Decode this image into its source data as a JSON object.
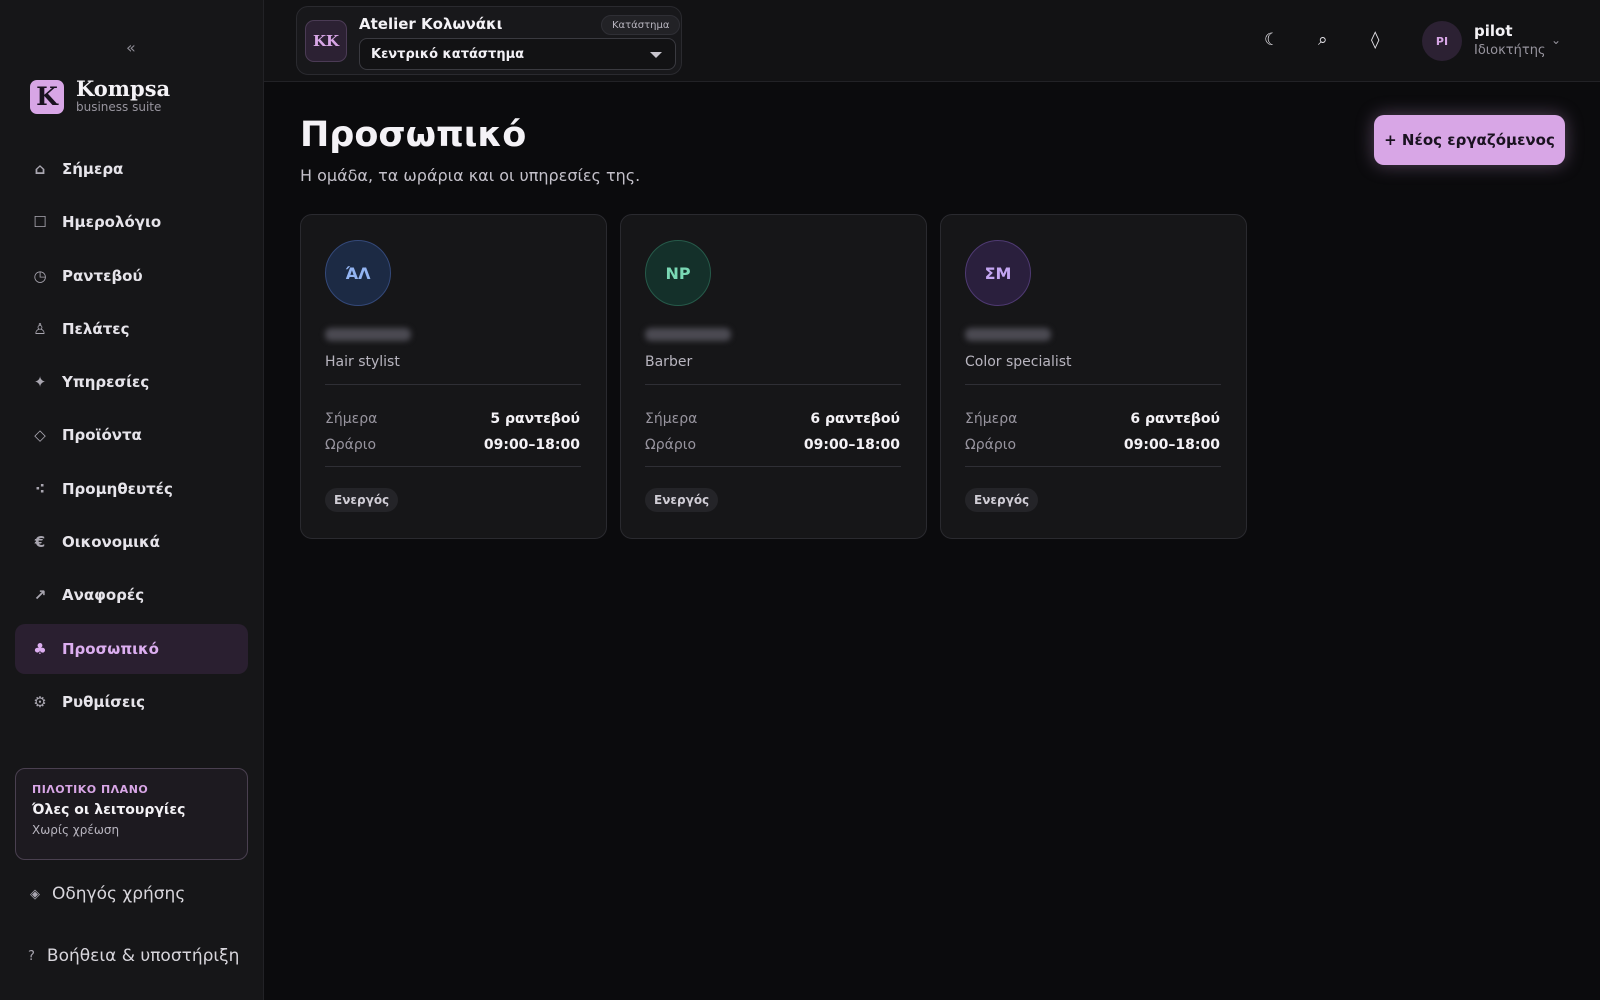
{
  "colors": {
    "accent": "#d8a6e6",
    "background": "#0b0b0d",
    "sidebar": "#161618",
    "card": "#161618"
  },
  "sidebar": {
    "collapse_icon": "«",
    "brand": {
      "letter": "K",
      "name": "Kompsa",
      "subtitle": "business suite"
    },
    "items": [
      {
        "label": "Σήμερα",
        "icon": "home-icon",
        "glyph": "⌂"
      },
      {
        "label": "Ημερολόγιο",
        "icon": "calendar-icon",
        "glyph": "☐"
      },
      {
        "label": "Ραντεβού",
        "icon": "clock-icon",
        "glyph": "◷"
      },
      {
        "label": "Πελάτες",
        "icon": "person-icon",
        "glyph": "♙"
      },
      {
        "label": "Υπηρεσίες",
        "icon": "sparkle-icon",
        "glyph": "✦"
      },
      {
        "label": "Προϊόντα",
        "icon": "diamond-icon",
        "glyph": "◇"
      },
      {
        "label": "Προμηθευτές",
        "icon": "dots-icon",
        "glyph": "⁖"
      },
      {
        "label": "Οικονομικά",
        "icon": "euro-icon",
        "glyph": "€"
      },
      {
        "label": "Αναφορές",
        "icon": "arrow-up-right-icon",
        "glyph": "↗"
      },
      {
        "label": "Προσωπικό",
        "icon": "club-icon",
        "glyph": "♣",
        "active": true
      },
      {
        "label": "Ρυθμίσεις",
        "icon": "gear-icon",
        "glyph": "⚙"
      }
    ],
    "plan": {
      "tag": "ΠΙΛΟΤΙΚΟ ΠΛΑΝΟ",
      "title": "Όλες οι λειτουργίες",
      "subtitle": "Χωρίς χρέωση"
    },
    "guide": {
      "glyph": "◈",
      "label": "Οδηγός χρήσης"
    },
    "help": {
      "glyph": "?",
      "label": "Βοήθεια & υποστήριξη"
    }
  },
  "topbar": {
    "store": {
      "initials": "KK",
      "name": "Atelier Κολωνάκι",
      "badge": "Κατάστημα",
      "selected": "Κεντρικό κατάστημα"
    },
    "icons": {
      "moon": "☾",
      "search": "⌕",
      "diamond": "◊"
    },
    "user": {
      "initials": "PI",
      "name": "pilot",
      "role": "Ιδιοκτήτης",
      "chevron": "⌄"
    }
  },
  "main": {
    "title": "Προσωπικό",
    "subtitle": "Η ομάδα, τα ωράρια και οι υπηρεσίες της.",
    "new_button": "+ Νέος εργαζόμενος",
    "staff": [
      {
        "initials": "ΆΛ",
        "role": "Hair stylist",
        "today_label": "Σήμερα",
        "today_value": "5 ραντεβού",
        "hours_label": "Ωράριο",
        "hours_value": "09:00–18:00",
        "status": "Ενεργός"
      },
      {
        "initials": "ΝΡ",
        "role": "Barber",
        "today_label": "Σήμερα",
        "today_value": "6 ραντεβού",
        "hours_label": "Ωράριο",
        "hours_value": "09:00–18:00",
        "status": "Ενεργός"
      },
      {
        "initials": "ΣΜ",
        "role": "Color specialist",
        "today_label": "Σήμερα",
        "today_value": "6 ραντεβού",
        "hours_label": "Ωράριο",
        "hours_value": "09:00–18:00",
        "status": "Ενεργός"
      }
    ]
  }
}
